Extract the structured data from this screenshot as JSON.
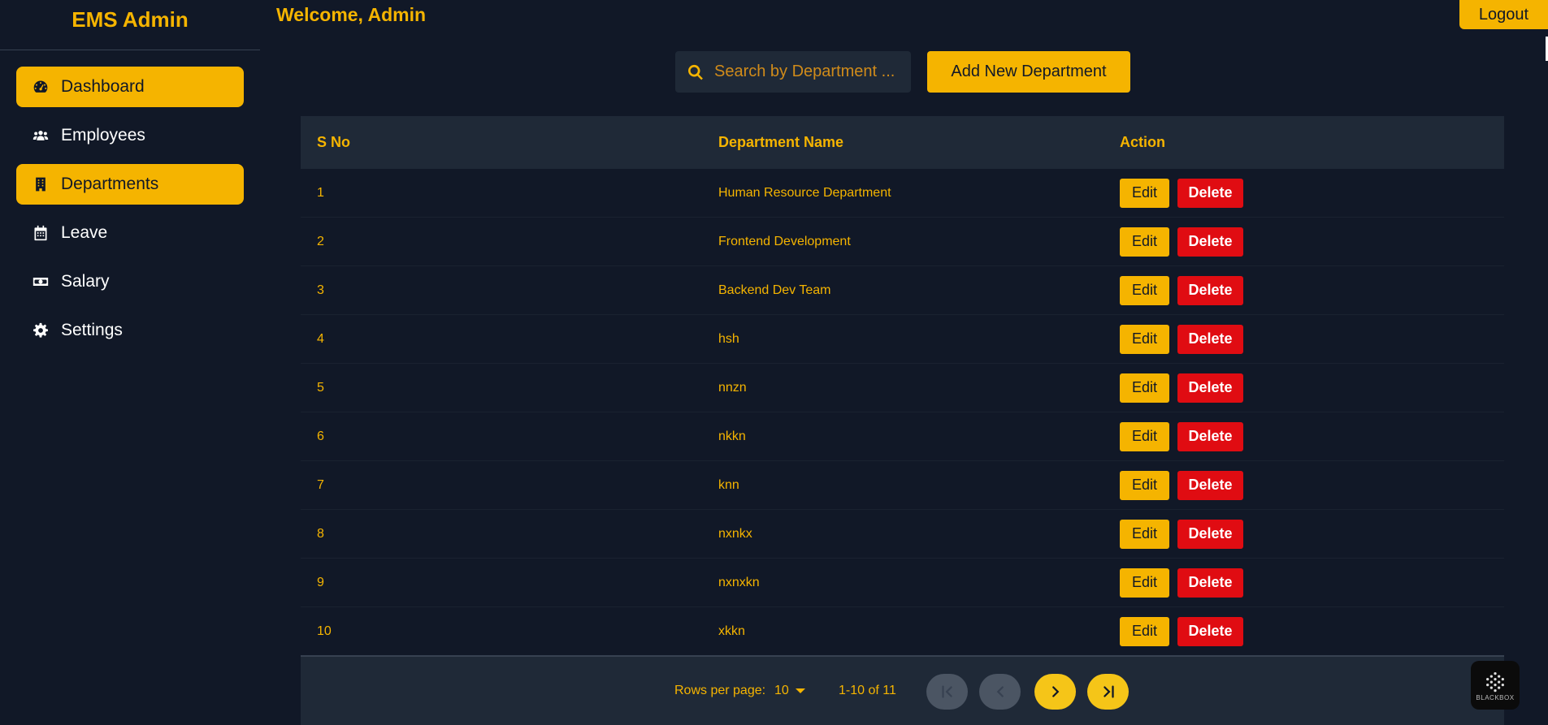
{
  "app": {
    "brand": "EMS Admin",
    "welcome": "Welcome, Admin",
    "logout_label": "Logout"
  },
  "sidebar": {
    "items": [
      {
        "label": "Dashboard",
        "icon": "tachometer-icon",
        "active": true
      },
      {
        "label": "Employees",
        "icon": "users-icon",
        "active": false
      },
      {
        "label": "Departments",
        "icon": "building-icon",
        "active": true
      },
      {
        "label": "Leave",
        "icon": "calendar-icon",
        "active": false
      },
      {
        "label": "Salary",
        "icon": "money-bill-icon",
        "active": false
      },
      {
        "label": "Settings",
        "icon": "gear-icon",
        "active": false
      }
    ]
  },
  "toolbar": {
    "search_placeholder": "Search by Department ...",
    "add_label": "Add New Department"
  },
  "table": {
    "headers": [
      "S No",
      "Department Name",
      "Action"
    ],
    "edit_label": "Edit",
    "delete_label": "Delete",
    "rows": [
      {
        "sno": "1",
        "name": "Human Resource Department"
      },
      {
        "sno": "2",
        "name": "Frontend Development"
      },
      {
        "sno": "3",
        "name": "Backend Dev Team"
      },
      {
        "sno": "4",
        "name": "hsh"
      },
      {
        "sno": "5",
        "name": "nnzn"
      },
      {
        "sno": "6",
        "name": "nkkn"
      },
      {
        "sno": "7",
        "name": "knn"
      },
      {
        "sno": "8",
        "name": "nxnkx"
      },
      {
        "sno": "9",
        "name": "nxnxkn"
      },
      {
        "sno": "10",
        "name": "xkkn"
      }
    ]
  },
  "pagination": {
    "rows_label": "Rows per page:",
    "rows_value": "10",
    "range": "1-10 of 11"
  },
  "badge": {
    "label": "BLACKBOX"
  },
  "colors": {
    "accent": "#f5b400",
    "background": "#111827",
    "panel": "#1f2937",
    "danger": "#e00c12"
  }
}
